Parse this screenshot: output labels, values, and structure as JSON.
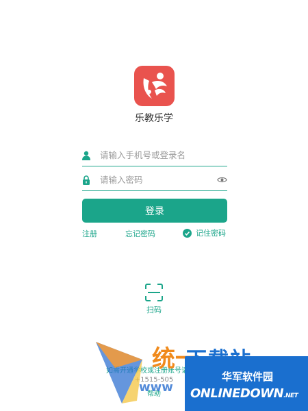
{
  "app": {
    "name": "乐教乐学"
  },
  "login_form": {
    "username_placeholder": "请输入手机号或登录名",
    "password_placeholder": "请输入密码",
    "login_button": "登录"
  },
  "links": {
    "register": "注册",
    "forgot_password": "忘记密码",
    "remember_password": "记住密码"
  },
  "scan": {
    "label": "扫码"
  },
  "footer": {
    "line1": "如需开通学校或注册账号请联系",
    "phone": "+1515-505",
    "help": "帮助"
  },
  "watermark": {
    "cn_title": "华军软件园",
    "en_title": "ONLINEDOWN",
    "en_suffix": ".NET",
    "top_text": "下载站",
    "mid_text": "统一",
    "www": "www"
  },
  "colors": {
    "accent": "#1ba58a",
    "logo": "#e9534e"
  }
}
